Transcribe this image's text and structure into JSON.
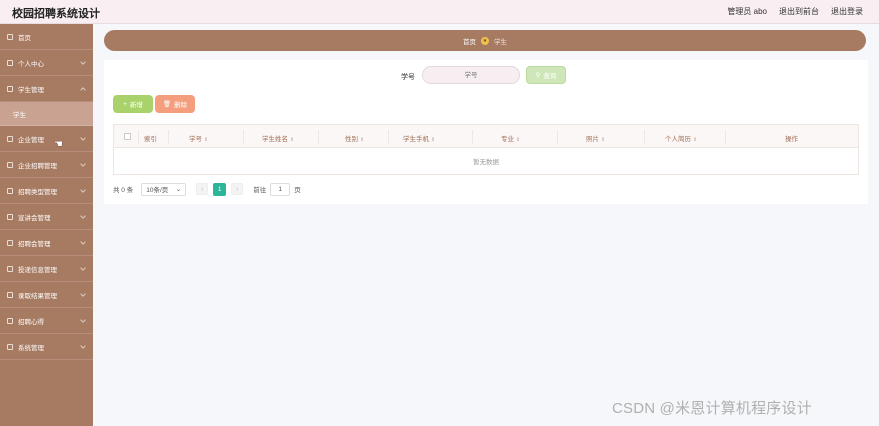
{
  "header": {
    "app_title": "校园招聘系统设计",
    "user_label": "管理员 abo",
    "exit_to_front": "退出到前台",
    "logout": "退出登录"
  },
  "sidebar": {
    "items": [
      {
        "label": "首页"
      },
      {
        "label": "个人中心"
      },
      {
        "label": "学生管理",
        "open": true,
        "children": [
          {
            "label": "学生"
          }
        ]
      },
      {
        "label": "企业管理"
      },
      {
        "label": "企业招聘管理"
      },
      {
        "label": "招聘类型管理"
      },
      {
        "label": "宣讲会管理"
      },
      {
        "label": "招聘会管理"
      },
      {
        "label": "投递信息管理"
      },
      {
        "label": "录取结果管理"
      },
      {
        "label": "招聘心得"
      },
      {
        "label": "系统管理"
      }
    ]
  },
  "breadcrumb": {
    "home": "首页",
    "current": "学生"
  },
  "search": {
    "label": "学号",
    "placeholder": "学号",
    "button_label": "查询"
  },
  "actions": {
    "add_label": "新增",
    "delete_label": "删除"
  },
  "table": {
    "columns": [
      "索引",
      "学号",
      "学生姓名",
      "性别",
      "学生手机",
      "专业",
      "照片",
      "个人简历",
      "操作"
    ],
    "empty_text": "暂无数据"
  },
  "pagination": {
    "total": "共 0 条",
    "page_size": "10条/页",
    "current_page": "1",
    "goto_label": "前往",
    "goto_value": "1",
    "page_unit": "页"
  },
  "watermark": "CSDN @米恩计算机程序设计"
}
